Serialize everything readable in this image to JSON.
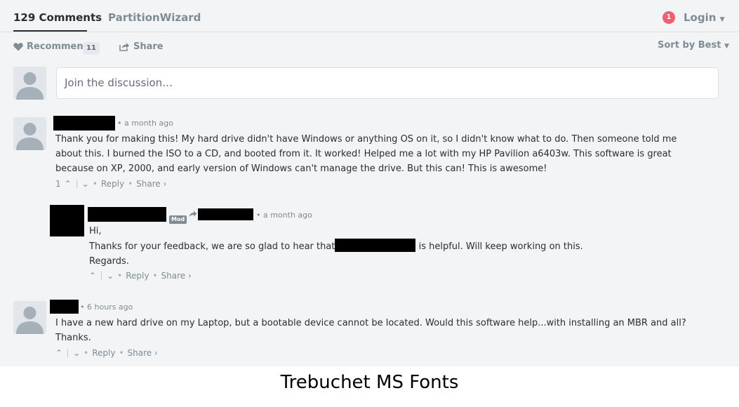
{
  "header": {
    "tabs": [
      {
        "label": "129 Comments"
      },
      {
        "label": "PartitionWizard"
      }
    ],
    "notification_count": "1",
    "login_label": "Login"
  },
  "toolbar": {
    "recommend_label": "Recommend",
    "recommend_count": "11",
    "share_label": "Share",
    "sort_label": "Sort by Best"
  },
  "composer": {
    "placeholder": "Join the discussion…"
  },
  "comments": [
    {
      "time": "a month ago",
      "lines": [
        "Thank you for making this! My hard drive didn't have Windows or anything OS on it, so I didn't know what to do. Then someone told me",
        "about this. I burned the ISO to a CD, and booted from it. It worked! Helped me a lot with my HP Pavilion a6403w. This software is great",
        "because on XP, 2000, and early version of Windows can't manage the drive. But this can! This is awesome!"
      ],
      "votes": "1",
      "reply_label": "Reply",
      "share_label": "Share ›"
    },
    {
      "mod_label": "Mod",
      "time": "a month ago",
      "line1": "Hi,",
      "line2_pre": "Thanks for your feedback, we are so glad to hear that",
      "line2_post": "is helpful. Will keep working on this.",
      "line3": "Regards.",
      "reply_label": "Reply",
      "share_label": "Share ›"
    },
    {
      "time": "6 hours ago",
      "lines": [
        "I have a new hard drive on my Laptop, but a bootable device cannot be located. Would this software help...with installing an MBR and all?",
        "Thanks."
      ],
      "reply_label": "Reply",
      "share_label": "Share ›"
    }
  ],
  "caption": "Trebuchet MS Fonts"
}
